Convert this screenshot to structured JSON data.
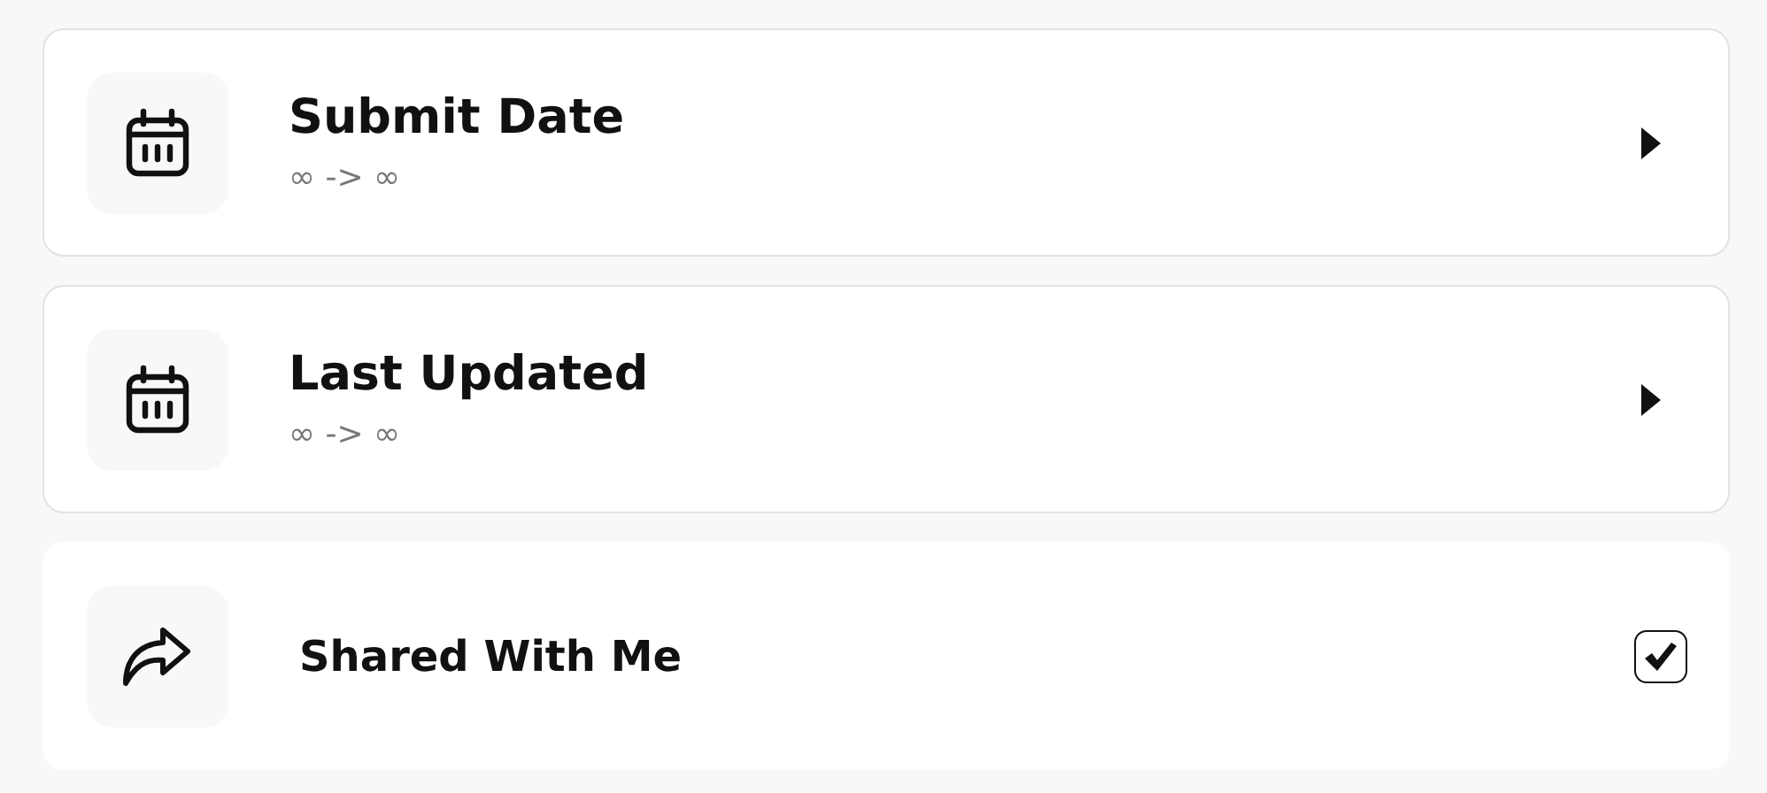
{
  "filters": [
    {
      "kind": "range",
      "title": "Submit Date",
      "range": "∞ -> ∞"
    },
    {
      "kind": "range",
      "title": "Last Updated",
      "range": "∞ -> ∞"
    },
    {
      "kind": "toggle",
      "title": "Shared With Me",
      "checked": true
    }
  ]
}
